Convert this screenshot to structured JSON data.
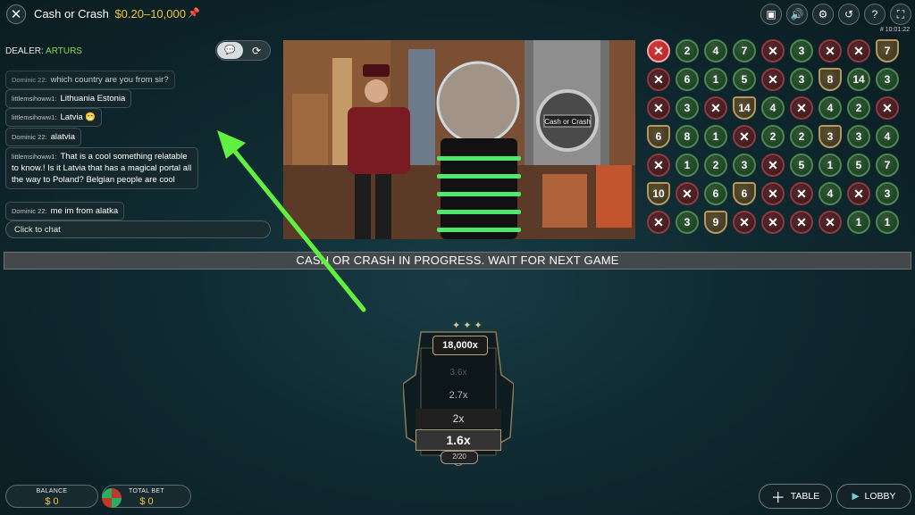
{
  "header": {
    "title": "Cash or Crash",
    "limits": "$0.20–10,000",
    "close_icon": "close-icon",
    "pin_icon": "pin-icon",
    "icons": [
      "video-icon",
      "volume-icon",
      "settings-icon",
      "history-icon",
      "help-icon",
      "fullscreen-icon"
    ],
    "clock": "# 10:01:22"
  },
  "dealer": {
    "label": "DEALER:",
    "name": "ARTURS"
  },
  "chat": {
    "toggle_chat_icon": "chat-icon",
    "toggle_rotate_icon": "rotate-icon",
    "messages": [
      {
        "user": "Dominic 22:",
        "text": "which country are you from sir?"
      },
      {
        "user": "littlemsihoww1:",
        "text": "Lithuania Estonia"
      },
      {
        "user": "littlemsihoww1:",
        "text": "Latvia 😁"
      },
      {
        "user": "Dominic 22:",
        "text": "alatvia"
      },
      {
        "user": "littlemsihoww1:",
        "text": "That is a cool something relatable to know.! Is it Latvia that has a magical portal all the way to Poland? Belgian people are cool"
      },
      {
        "user": "Dominic 22:",
        "text": "me im from alatka"
      }
    ],
    "placeholder": "Click to chat"
  },
  "status_bar": "CASH OR CRASH IN PROGRESS. WAIT FOR NEXT GAME",
  "history": {
    "colors": {
      "green": "#4e8653",
      "red": "#8e3b3c",
      "gold": "#b59a5a"
    },
    "rows": [
      [
        "xr",
        "2",
        "4",
        "7",
        "x",
        "3",
        "x",
        "x",
        "s7"
      ],
      [
        "x",
        "6",
        "1",
        "5",
        "x",
        "3",
        "s8",
        "14",
        "3"
      ],
      [
        "x",
        "3",
        "x",
        "s14",
        "4",
        "x",
        "4",
        "2",
        "x"
      ],
      [
        "s6",
        "8",
        "1",
        "x",
        "2",
        "2",
        "s3",
        "3",
        "4"
      ],
      [
        "x",
        "1",
        "2",
        "3",
        "x",
        "5",
        "1",
        "5",
        "7"
      ],
      [
        "s10",
        "x",
        "6",
        "s6",
        "x",
        "x",
        "4",
        "x",
        "3"
      ],
      [
        "x",
        "3",
        "s9",
        "x",
        "x",
        "x",
        "x",
        "1",
        "1"
      ]
    ]
  },
  "meter": {
    "top": "18,000x",
    "levels": [
      "3.6x",
      "2.7x",
      "2x",
      "1.6x"
    ],
    "progress": "2/20"
  },
  "footer": {
    "balance_label": "BALANCE",
    "balance_value": "$ 0",
    "total_bet_label": "TOTAL BET",
    "total_bet_value": "$ 0",
    "table_label": "TABLE",
    "lobby_label": "LOBBY"
  }
}
